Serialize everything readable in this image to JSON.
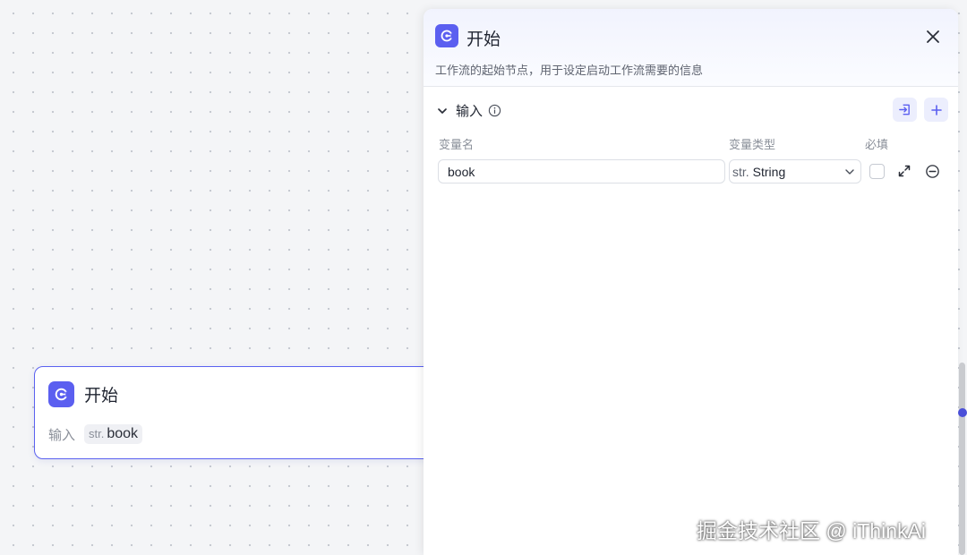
{
  "canvas_node": {
    "title": "开始",
    "input_label": "输入",
    "variable": {
      "type_prefix": "str.",
      "name": "book"
    }
  },
  "panel": {
    "title": "开始",
    "description": "工作流的起始节点，用于设定启动工作流需要的信息",
    "section": {
      "title": "输入"
    },
    "columns": {
      "name": "变量名",
      "type": "变量类型",
      "required": "必填"
    },
    "rows": [
      {
        "name": "book",
        "type_prefix": "str.",
        "type": "String",
        "required": false
      }
    ]
  },
  "icons": {
    "logo": "start-logo-icon",
    "close": "close-icon",
    "collapse": "chevron-down-icon",
    "info": "info-icon",
    "import": "import-icon",
    "add": "plus-icon",
    "expand": "expand-icon",
    "remove": "minus-circle-icon"
  },
  "watermark": "掘金技术社区 @ iThinkAi",
  "colors": {
    "accent": "#5b5ff0",
    "node_border": "#5b62f0",
    "canvas_bg": "#f4f5f7",
    "panel_header_bg": "#f1f3fe",
    "icon_button_bg": "#eceefd"
  }
}
